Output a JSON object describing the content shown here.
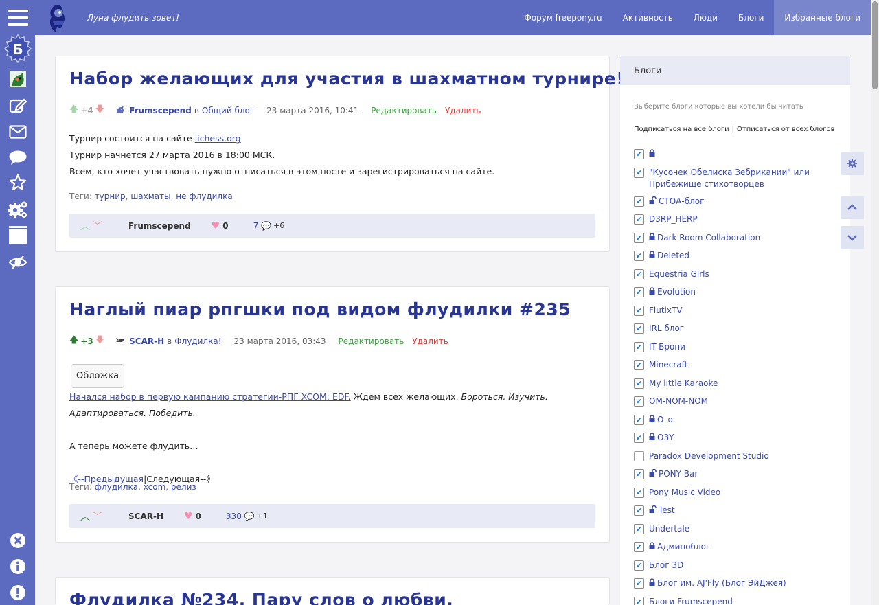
{
  "header": {
    "tagline": "Луна флудить зовет!",
    "nav": [
      {
        "label": "Форум freepony.ru",
        "active": false
      },
      {
        "label": "Активность",
        "active": false
      },
      {
        "label": "Люди",
        "active": false
      },
      {
        "label": "Блоги",
        "active": false
      },
      {
        "label": "Избранные блоги",
        "active": true
      }
    ]
  },
  "sidebar": {
    "badge_letter": "Б"
  },
  "posts": [
    {
      "title": "Набор желающих для участия в шахматном турнире!",
      "rating": "+4",
      "author": "Frumscepend",
      "in_word": "в",
      "blog": "Общий блог",
      "date": "23 марта 2016, 10:41",
      "edit_label": "Редактировать",
      "delete_label": "Удалить",
      "body_line1_text": "Турнир состоится на сайте ",
      "body_line1_link": "lichess.org",
      "body_line2": "Турнир начнется 27 марта 2016 в 18:00 МСК.",
      "body_line3": "Всем, кто хочет участвовать нужно отписаться в этом посте и зарегистрироваться на сайте.",
      "tags_label": "Теги:",
      "tags": [
        "турнир",
        "шахматы",
        "не флудилка"
      ],
      "footer_author": "Frumscepend",
      "favourites": "0",
      "comments": "7",
      "new_comments": "+6"
    },
    {
      "title": "Наглый пиар рпгшки под видом флудилки #235",
      "rating": "+3",
      "author": "SCAR-H",
      "in_word": "в",
      "blog": "Флудилка!",
      "date": "23 марта 2016, 03:43",
      "edit_label": "Редактировать",
      "delete_label": "Удалить",
      "cover_label": "Обложка",
      "body_link": "Начался набор в первую кампанию стратегии-РПГ XCOM: EDF.",
      "body_text": " Ждем всех желающих. ",
      "body_italic": "Бороться. Изучить. Адаптироваться. Победить.",
      "body_line2": "А теперь можете флудить…",
      "prev_link": "《--Предыдущая",
      "sep": "|",
      "next_text": "Следующая--》",
      "tags_label": "Теги:",
      "tags": [
        "флудилка",
        "xcom",
        "релиз"
      ],
      "footer_author": "SCAR-H",
      "favourites": "0",
      "comments": "330",
      "new_comments": "+1"
    },
    {
      "title": "Флудилка №234. Пару слов о любви."
    }
  ],
  "right_panel": {
    "title": "Блоги",
    "description": "Выберите блоги которые вы хотели бы читать",
    "subscribe_all": "Подписаться на все блоги",
    "separator": "|",
    "unsubscribe_all": "Отписаться от всех блогов",
    "blogs": [
      {
        "label": "",
        "checked": true,
        "lock": "closed"
      },
      {
        "label": "\"Кусочек Обелиска Зебрикании\" или Прибежище стихотворцев",
        "checked": true,
        "lock": "none"
      },
      {
        "label": "СТОА-блог",
        "checked": true,
        "lock": "open"
      },
      {
        "label": "D3RP_HERP",
        "checked": true,
        "lock": "none"
      },
      {
        "label": "Dark Room Collaboration",
        "checked": true,
        "lock": "closed"
      },
      {
        "label": "Deleted",
        "checked": true,
        "lock": "closed"
      },
      {
        "label": "Equestria Girls",
        "checked": true,
        "lock": "none"
      },
      {
        "label": "Evolution",
        "checked": true,
        "lock": "closed"
      },
      {
        "label": "FlutixTV",
        "checked": true,
        "lock": "none"
      },
      {
        "label": "IRL блог",
        "checked": true,
        "lock": "none"
      },
      {
        "label": "IT-Брони",
        "checked": true,
        "lock": "none"
      },
      {
        "label": "Minecraft",
        "checked": true,
        "lock": "none"
      },
      {
        "label": "My little Karaoke",
        "checked": true,
        "lock": "none"
      },
      {
        "label": "OM-NOM-NOM",
        "checked": true,
        "lock": "none"
      },
      {
        "label": "O_o",
        "checked": true,
        "lock": "closed"
      },
      {
        "label": "O3Y",
        "checked": true,
        "lock": "closed"
      },
      {
        "label": "Paradox Development Studio",
        "checked": false,
        "lock": "none"
      },
      {
        "label": "PONY Bar",
        "checked": true,
        "lock": "open"
      },
      {
        "label": "Pony Music Video",
        "checked": true,
        "lock": "none"
      },
      {
        "label": "Test",
        "checked": true,
        "lock": "open"
      },
      {
        "label": "Undertale",
        "checked": true,
        "lock": "none"
      },
      {
        "label": "Админоблог",
        "checked": true,
        "lock": "closed"
      },
      {
        "label": "Блог 3D",
        "checked": true,
        "lock": "none"
      },
      {
        "label": "Блог им. AJ'Fly (Блог ЭйДжея)",
        "checked": true,
        "lock": "closed"
      },
      {
        "label": "Блоги Frumscepend",
        "checked": true,
        "lock": "none"
      }
    ]
  },
  "colors": {
    "primary": "#5c6bc0",
    "title": "#283593",
    "link": "#3949ab",
    "edit": "#43a047",
    "delete": "#e53935",
    "footer_bg": "#e8eaf6"
  }
}
